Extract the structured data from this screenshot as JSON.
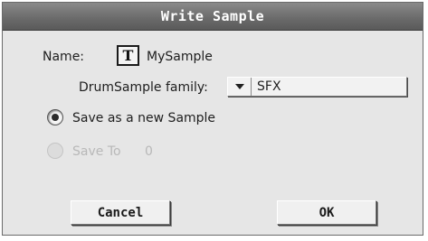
{
  "dialog": {
    "title": "Write Sample",
    "name_label": "Name:",
    "text_edit_icon_glyph": "T",
    "name_value": "MySample",
    "family_label": "DrumSample family:",
    "family_value": "SFX",
    "save_new_label": "Save as a new Sample",
    "save_new_selected": true,
    "save_to_label": "Save To",
    "save_to_value": "0",
    "save_to_enabled": false,
    "cancel_label": "Cancel",
    "ok_label": "OK"
  },
  "icons": [
    "text-edit-icon",
    "dropdown-arrow-icon",
    "radio-selected-icon",
    "radio-disabled-icon"
  ]
}
